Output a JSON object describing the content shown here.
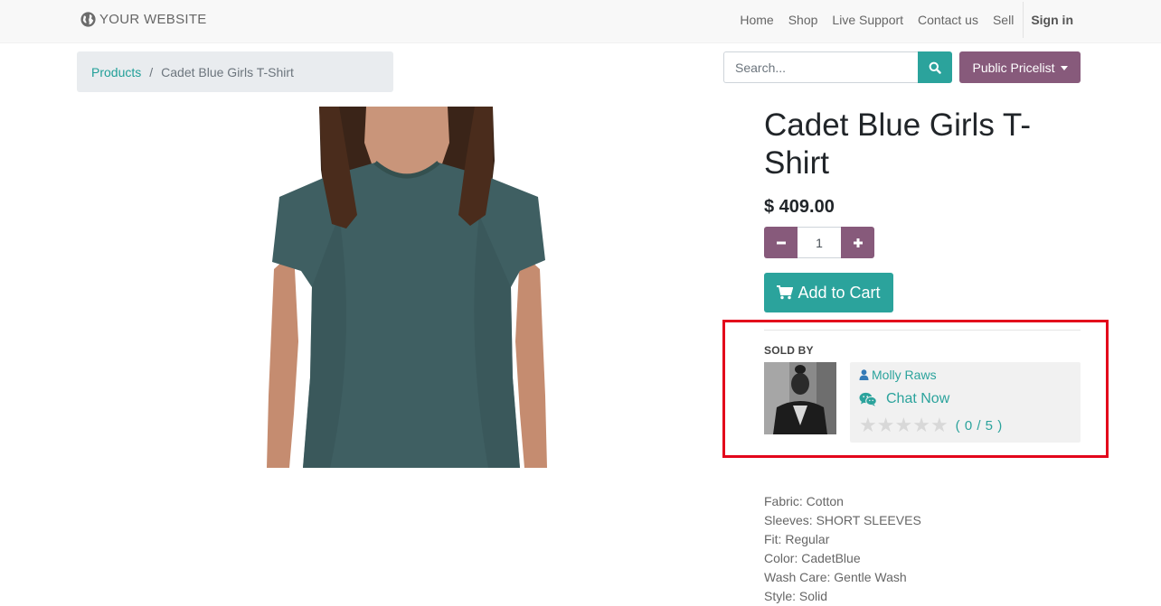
{
  "header": {
    "logo_text": "YOUR WEBSITE",
    "nav": [
      "Home",
      "Shop",
      "Live Support",
      "Contact us",
      "Sell"
    ],
    "signin": "Sign in"
  },
  "breadcrumb": {
    "link": "Products",
    "separator": "/",
    "current": "Cadet Blue Girls T-Shirt"
  },
  "search": {
    "placeholder": "Search..."
  },
  "pricelist": {
    "label": "Public Pricelist"
  },
  "product": {
    "title": "Cadet Blue Girls T-Shirt",
    "price": "$ 409.00",
    "quantity": "1",
    "add_to_cart": "Add to Cart",
    "attributes": [
      "Fabric: Cotton",
      "Sleeves: SHORT SLEEVES",
      "Fit: Regular",
      "Color: CadetBlue",
      "Wash Care: Gentle Wash",
      "Style: Solid"
    ]
  },
  "seller": {
    "section_label": "SOLD BY",
    "name": "Molly Raws",
    "chat_label": "Chat Now",
    "rating": 0,
    "rating_text": "( 0 / 5 )"
  },
  "colors": {
    "accent_teal": "#2ba39c",
    "brand_purple": "#875a7b",
    "highlight_red": "#e3051b"
  }
}
